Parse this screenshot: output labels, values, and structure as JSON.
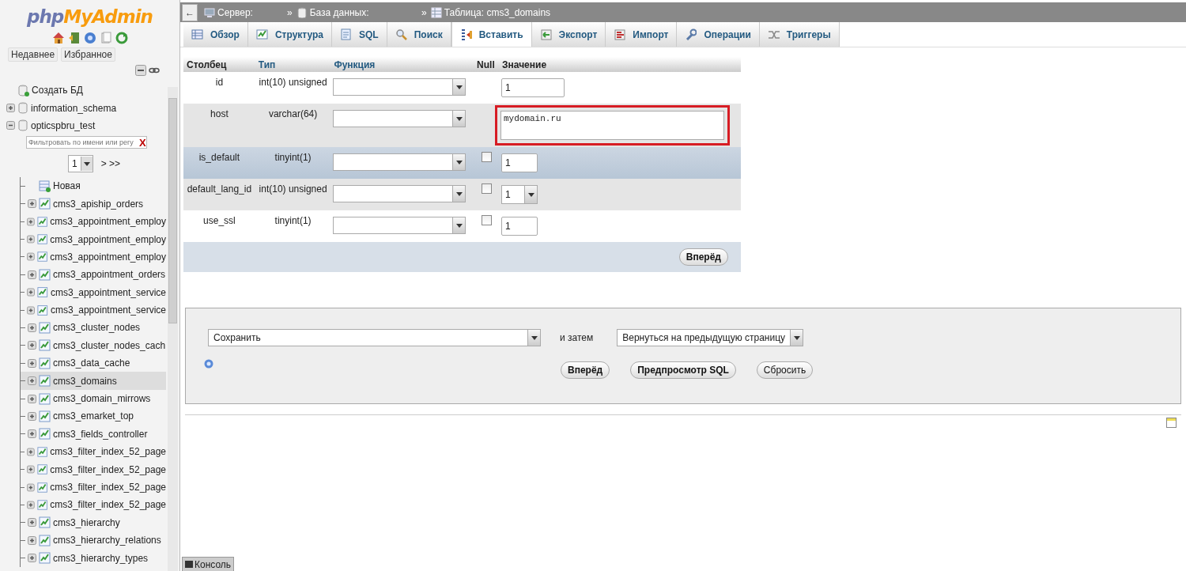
{
  "sidebar": {
    "logo": {
      "part_1": "php",
      "part_2": "MyAdmin"
    },
    "buttons": [
      {
        "label": "Недавнее"
      },
      {
        "label": "Избранное"
      }
    ],
    "tree": [
      {
        "label": "Создать БД",
        "kind": "new"
      },
      {
        "label": "information_schema",
        "kind": "db",
        "expanded": false
      },
      {
        "label": "opticspbru_test",
        "kind": "db",
        "expanded": true,
        "filter_placeholder": "Фильтровать по имени или регу",
        "filter_clear": "X",
        "page": "1",
        "page_nav": "> >>",
        "children": [
          {
            "label": "Новая",
            "kind": "new",
            "selected": false
          },
          {
            "label": "cms3_apiship_orders",
            "kind": "table",
            "selected": false
          },
          {
            "label": "cms3_appointment_employ",
            "kind": "table",
            "selected": false
          },
          {
            "label": "cms3_appointment_employ",
            "kind": "table",
            "selected": false
          },
          {
            "label": "cms3_appointment_employ",
            "kind": "table",
            "selected": false
          },
          {
            "label": "cms3_appointment_orders",
            "kind": "table",
            "selected": false
          },
          {
            "label": "cms3_appointment_service",
            "kind": "table",
            "selected": false
          },
          {
            "label": "cms3_appointment_service",
            "kind": "table",
            "selected": false
          },
          {
            "label": "cms3_cluster_nodes",
            "kind": "table",
            "selected": false
          },
          {
            "label": "cms3_cluster_nodes_cach",
            "kind": "table",
            "selected": false
          },
          {
            "label": "cms3_data_cache",
            "kind": "table",
            "selected": false
          },
          {
            "label": "cms3_domains",
            "kind": "table",
            "selected": true
          },
          {
            "label": "cms3_domain_mirrows",
            "kind": "table",
            "selected": false
          },
          {
            "label": "cms3_emarket_top",
            "kind": "table",
            "selected": false
          },
          {
            "label": "cms3_fields_controller",
            "kind": "table",
            "selected": false
          },
          {
            "label": "cms3_filter_index_52_page",
            "kind": "table",
            "selected": false
          },
          {
            "label": "cms3_filter_index_52_page",
            "kind": "table",
            "selected": false
          },
          {
            "label": "cms3_filter_index_52_page",
            "kind": "table",
            "selected": false
          },
          {
            "label": "cms3_filter_index_52_page",
            "kind": "table",
            "selected": false
          },
          {
            "label": "cms3_hierarchy",
            "kind": "table",
            "selected": false
          },
          {
            "label": "cms3_hierarchy_relations",
            "kind": "table",
            "selected": false
          },
          {
            "label": "cms3_hierarchy_types",
            "kind": "table",
            "selected": false
          }
        ]
      }
    ]
  },
  "back_button": "←",
  "breadcrumb": [
    {
      "label": "Сервер:",
      "kind": "server"
    },
    {
      "separator": "»",
      "label": "База данных:",
      "kind": "database"
    },
    {
      "separator": "»",
      "label": "Таблица: cms3_domains",
      "kind": "table"
    }
  ],
  "tabs": [
    {
      "label": "Обзор",
      "kind": "browse",
      "selected": false
    },
    {
      "label": "Структура",
      "kind": "structure",
      "selected": false
    },
    {
      "label": "SQL",
      "kind": "sql",
      "selected": false
    },
    {
      "label": "Поиск",
      "kind": "search",
      "selected": false
    },
    {
      "label": "Вставить",
      "kind": "insert",
      "selected": true
    },
    {
      "label": "Экспорт",
      "kind": "export",
      "selected": false
    },
    {
      "label": "Импорт",
      "kind": "import",
      "selected": false
    },
    {
      "label": "Операции",
      "kind": "operations",
      "selected": false
    },
    {
      "label": "Триггеры",
      "kind": "triggers",
      "selected": false
    }
  ],
  "insert_table": {
    "columns": [
      {
        "label": "Столбец",
        "link": false
      },
      {
        "label": "Тип",
        "link": true
      },
      {
        "label": "Функция",
        "link": true
      },
      {
        "label": "Null",
        "link": false
      },
      {
        "label": "Значение",
        "link": false
      }
    ],
    "rows": [
      {
        "column": "id",
        "type": "int(10) unsigned",
        "highlighted": false,
        "kind": "input",
        "value": "1"
      },
      {
        "column": "host",
        "type": "varchar(64)",
        "highlighted": false,
        "kind": "textarea",
        "value": "mydomain.ru",
        "marked": true
      },
      {
        "column": "is_default",
        "type": "tinyint(1)",
        "highlighted": true,
        "null_checked": false,
        "kind": "input",
        "value": "1"
      },
      {
        "column": "default_lang_id",
        "type": "int(10) unsigned",
        "highlighted": false,
        "null_checked": false,
        "kind": "select",
        "value": "1"
      },
      {
        "column": "use_ssl",
        "type": "tinyint(1)",
        "highlighted": false,
        "null_checked": false,
        "kind": "input",
        "value": "1"
      }
    ],
    "submit": "Вперёд"
  },
  "actions": {
    "action": "Сохранить",
    "then_label": "и затем",
    "after": "Вернуться на предыдущую страницу",
    "buttons": [
      {
        "label": "Вперёд",
        "bold": true
      },
      {
        "label": "Предпросмотр SQL",
        "bold": true
      },
      {
        "label": "Сбросить",
        "bold": false
      }
    ]
  },
  "console": {
    "label": "Консоль"
  }
}
